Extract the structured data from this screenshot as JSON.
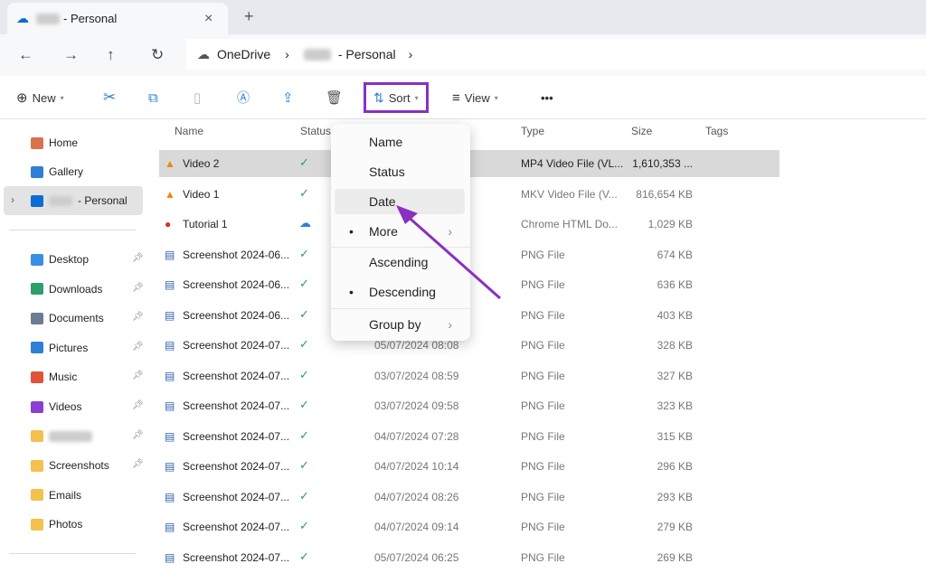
{
  "tab": {
    "title": "- Personal",
    "close": "×",
    "new_tab": "+"
  },
  "nav": {
    "back": "←",
    "forward": "→",
    "up": "↑",
    "refresh": "↻",
    "breadcrumb": [
      "OneDrive",
      "- Personal"
    ],
    "sep": "›"
  },
  "toolbar": {
    "new_label": "New",
    "sort_label": "Sort",
    "view_label": "View",
    "more": "•••"
  },
  "sidebar": {
    "top": [
      {
        "label": "Home",
        "color": "#d9734a"
      },
      {
        "label": "Gallery",
        "color": "#2f7fd6"
      },
      {
        "label": "- Personal",
        "color": "#0a6cd6"
      }
    ],
    "quick": [
      {
        "label": "Desktop",
        "color": "#3a8ee6"
      },
      {
        "label": "Downloads",
        "color": "#2e9e6a"
      },
      {
        "label": "Documents",
        "color": "#6b7c93"
      },
      {
        "label": "Pictures",
        "color": "#2f7fd6"
      },
      {
        "label": "Music",
        "color": "#e0533a"
      },
      {
        "label": "Videos",
        "color": "#8a3fd1"
      },
      {
        "label": "",
        "color": "#f2c14e"
      },
      {
        "label": "Screenshots",
        "color": "#f2c14e"
      },
      {
        "label": "Emails",
        "color": "#f2c14e"
      },
      {
        "label": "Photos",
        "color": "#f2c14e"
      }
    ]
  },
  "columns": {
    "name": "Name",
    "status": "Status",
    "type": "Type",
    "size": "Size",
    "tags": "Tags"
  },
  "files": [
    {
      "name": "Video 2",
      "status": "synced",
      "date": "",
      "type": "MP4 Video File (VL...",
      "size": "1,610,353 ...",
      "icon": "vlc",
      "selected": true
    },
    {
      "name": "Video 1",
      "status": "synced",
      "date": "",
      "type": "MKV Video File (V...",
      "size": "816,654 KB",
      "icon": "vlc"
    },
    {
      "name": "Tutorial 1",
      "status": "cloud",
      "date": "",
      "type": "Chrome HTML Do...",
      "size": "1,029 KB",
      "icon": "chrome"
    },
    {
      "name": "Screenshot 2024-06...",
      "status": "synced",
      "date": "",
      "type": "PNG File",
      "size": "674 KB",
      "icon": "png"
    },
    {
      "name": "Screenshot 2024-06...",
      "status": "synced",
      "date": "",
      "type": "PNG File",
      "size": "636 KB",
      "icon": "png"
    },
    {
      "name": "Screenshot 2024-06...",
      "status": "synced",
      "date": "",
      "type": "PNG File",
      "size": "403 KB",
      "icon": "png"
    },
    {
      "name": "Screenshot 2024-07...",
      "status": "synced",
      "date": "05/07/2024 08:08",
      "type": "PNG File",
      "size": "328 KB",
      "icon": "png"
    },
    {
      "name": "Screenshot 2024-07...",
      "status": "synced",
      "date": "03/07/2024 08:59",
      "type": "PNG File",
      "size": "327 KB",
      "icon": "png"
    },
    {
      "name": "Screenshot 2024-07...",
      "status": "synced",
      "date": "03/07/2024 09:58",
      "type": "PNG File",
      "size": "323 KB",
      "icon": "png"
    },
    {
      "name": "Screenshot 2024-07...",
      "status": "synced",
      "date": "04/07/2024 07:28",
      "type": "PNG File",
      "size": "315 KB",
      "icon": "png"
    },
    {
      "name": "Screenshot 2024-07...",
      "status": "synced",
      "date": "04/07/2024 10:14",
      "type": "PNG File",
      "size": "296 KB",
      "icon": "png"
    },
    {
      "name": "Screenshot 2024-07...",
      "status": "synced",
      "date": "04/07/2024 08:26",
      "type": "PNG File",
      "size": "293 KB",
      "icon": "png"
    },
    {
      "name": "Screenshot 2024-07...",
      "status": "synced",
      "date": "04/07/2024 09:14",
      "type": "PNG File",
      "size": "279 KB",
      "icon": "png"
    },
    {
      "name": "Screenshot 2024-07...",
      "status": "synced",
      "date": "05/07/2024 06:25",
      "type": "PNG File",
      "size": "269 KB",
      "icon": "png"
    }
  ],
  "sort_menu": {
    "items": [
      {
        "label": "Name"
      },
      {
        "label": "Status"
      },
      {
        "label": "Date",
        "highlighted": true
      },
      {
        "label": "More",
        "checked": true,
        "submenu": true
      }
    ],
    "order": [
      {
        "label": "Ascending"
      },
      {
        "label": "Descending",
        "checked": true
      }
    ],
    "group": {
      "label": "Group by",
      "submenu": true
    }
  },
  "colors": {
    "accent": "#8a2fc2",
    "selection": "#d9d9d9"
  }
}
